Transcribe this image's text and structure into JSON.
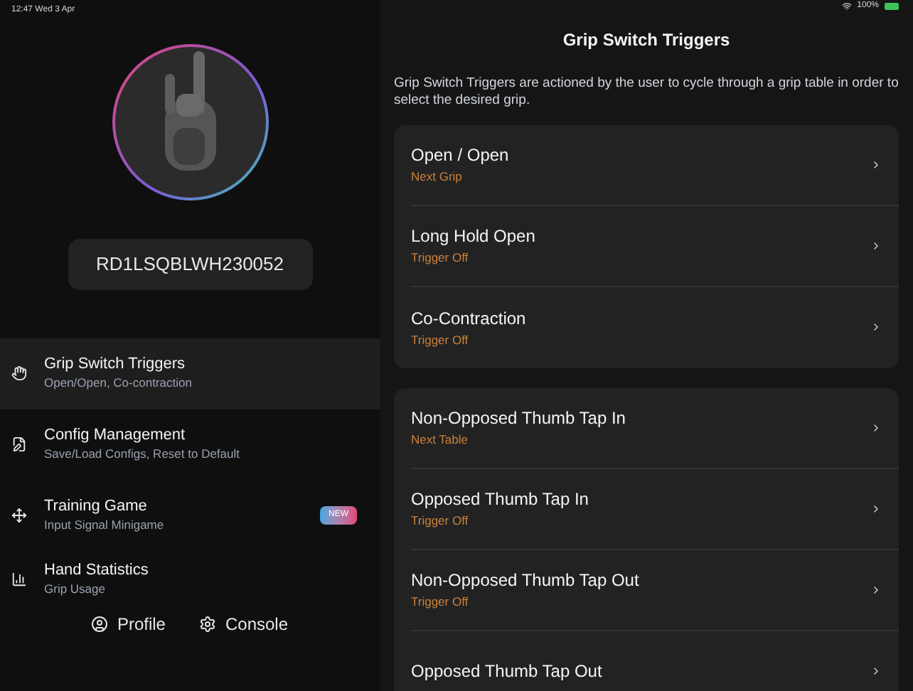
{
  "status_bar": {
    "time": "12:47  Wed 3 Apr",
    "battery": "100%"
  },
  "sidebar": {
    "device_id": "RD1LSQBLWH230052",
    "items": [
      {
        "kind": "triggers",
        "title": "Grip Switch Triggers",
        "subtitle": "Open/Open, Co-contraction",
        "selected": true
      },
      {
        "kind": "config",
        "title": "Config Management",
        "subtitle": "Save/Load Configs, Reset to Default",
        "selected": false
      },
      {
        "kind": "game",
        "title": "Training Game",
        "subtitle": "Input Signal Minigame",
        "selected": false,
        "badge": "NEW"
      },
      {
        "kind": "stats",
        "title": "Hand Statistics",
        "subtitle": "Grip Usage",
        "selected": false
      }
    ],
    "footer": [
      {
        "kind": "profile",
        "label": "Profile"
      },
      {
        "kind": "console",
        "label": "Console"
      }
    ]
  },
  "detail": {
    "title": "Grip Switch Triggers",
    "description": "Grip Switch Triggers are actioned by the user to cycle through a grip table in order to select the desired grip.",
    "groups": [
      [
        {
          "title": "Open / Open",
          "value": "Next Grip"
        },
        {
          "title": "Long Hold Open",
          "value": "Trigger Off"
        },
        {
          "title": "Co-Contraction",
          "value": "Trigger Off"
        }
      ],
      [
        {
          "title": "Non-Opposed Thumb Tap In",
          "value": "Next Table"
        },
        {
          "title": "Opposed Thumb Tap In",
          "value": "Trigger Off"
        },
        {
          "title": "Non-Opposed Thumb Tap Out",
          "value": "Trigger Off"
        },
        {
          "title": "Opposed Thumb Tap Out"
        }
      ]
    ]
  }
}
